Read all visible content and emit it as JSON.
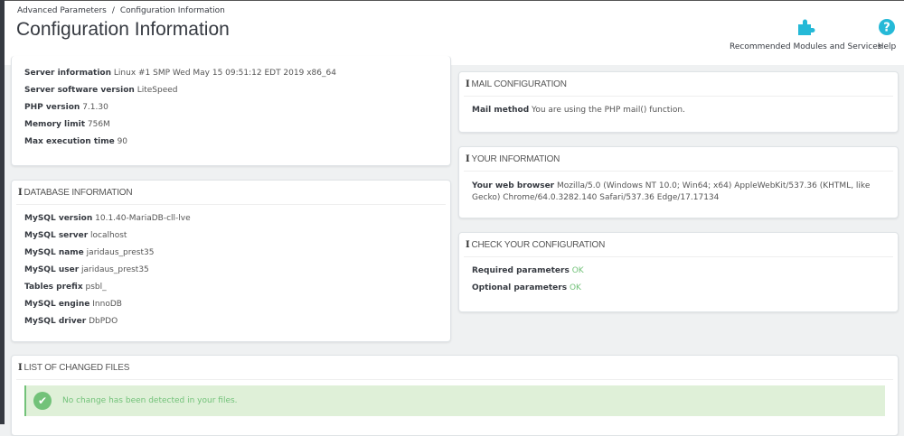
{
  "breadcrumb": [
    "Advanced Parameters",
    "/",
    "Configuration Information"
  ],
  "page_title": "Configuration Information",
  "toolbar": {
    "modules_label": "Recommended Modules and Services",
    "help_label": "Help"
  },
  "server": {
    "rows": [
      {
        "k": "Server information",
        "v": "Linux #1 SMP Wed May 15 09:51:12 EDT 2019 x86_64"
      },
      {
        "k": "Server software version",
        "v": "LiteSpeed"
      },
      {
        "k": "PHP version",
        "v": "7.1.30"
      },
      {
        "k": "Memory limit",
        "v": "756M"
      },
      {
        "k": "Max execution time",
        "v": "90"
      }
    ]
  },
  "database": {
    "title": "Database information",
    "rows": [
      {
        "k": "MySQL version",
        "v": "10.1.40-MariaDB-cll-lve"
      },
      {
        "k": "MySQL server",
        "v": "localhost"
      },
      {
        "k": "MySQL name",
        "v": "jaridaus_prest35"
      },
      {
        "k": "MySQL user",
        "v": "jaridaus_prest35"
      },
      {
        "k": "Tables prefix",
        "v": "psbl_"
      },
      {
        "k": "MySQL engine",
        "v": "InnoDB"
      },
      {
        "k": "MySQL driver",
        "v": "DbPDO"
      }
    ]
  },
  "mail": {
    "title": "Mail configuration",
    "k": "Mail method",
    "v": "You are using the PHP mail() function."
  },
  "your_info": {
    "title": "Your information",
    "k": "Your web browser",
    "v": "Mozilla/5.0 (Windows NT 10.0; Win64; x64) AppleWebKit/537.36 (KHTML, like Gecko) Chrome/64.0.3282.140 Safari/537.36 Edge/17.17134"
  },
  "check": {
    "title": "Check your configuration",
    "rows": [
      {
        "k": "Required parameters",
        "v": "OK"
      },
      {
        "k": "Optional parameters",
        "v": "OK"
      }
    ]
  },
  "changed": {
    "title": "List of changed files",
    "message": "No change has been detected in your files."
  },
  "icons": {
    "info": "i",
    "check": "✔"
  }
}
